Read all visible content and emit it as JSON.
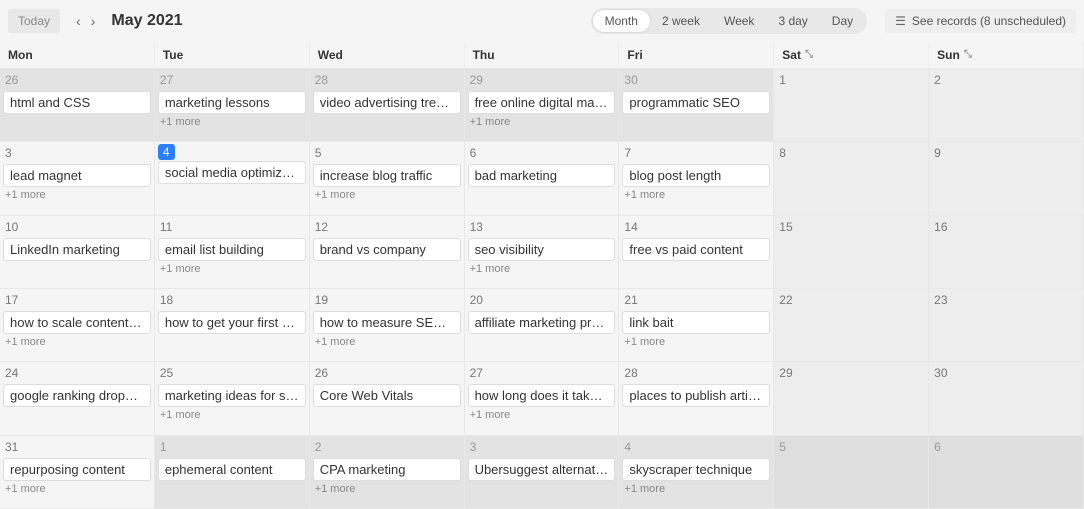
{
  "toolbar": {
    "today_label": "Today",
    "title": "May 2021",
    "views": [
      "Month",
      "2 week",
      "Week",
      "3 day",
      "Day"
    ],
    "active_view": 0,
    "records_label": "See records (8 unscheduled)"
  },
  "day_headers": [
    "Mon",
    "Tue",
    "Wed",
    "Thu",
    "Fri",
    "Sat",
    "Sun"
  ],
  "weeks": [
    [
      {
        "date": 26,
        "out": true,
        "events": [
          "html and CSS"
        ],
        "more": null
      },
      {
        "date": 27,
        "out": true,
        "events": [
          "marketing lessons"
        ],
        "more": "+1 more"
      },
      {
        "date": 28,
        "out": true,
        "events": [
          "video advertising trends"
        ],
        "more": null
      },
      {
        "date": 29,
        "out": true,
        "events": [
          "free online digital marketing"
        ],
        "more": "+1 more"
      },
      {
        "date": 30,
        "out": true,
        "events": [
          "programmatic SEO"
        ],
        "more": null
      },
      {
        "date": 1,
        "out": false,
        "weekend": true,
        "events": [],
        "more": null
      },
      {
        "date": 2,
        "out": false,
        "weekend": true,
        "events": [],
        "more": null
      }
    ],
    [
      {
        "date": 3,
        "out": false,
        "events": [
          "lead magnet"
        ],
        "more": "+1 more"
      },
      {
        "date": 4,
        "out": false,
        "today": true,
        "events": [
          "social media optimization"
        ],
        "more": null
      },
      {
        "date": 5,
        "out": false,
        "events": [
          "increase blog traffic"
        ],
        "more": "+1 more"
      },
      {
        "date": 6,
        "out": false,
        "events": [
          "bad marketing"
        ],
        "more": null
      },
      {
        "date": 7,
        "out": false,
        "events": [
          "blog post length"
        ],
        "more": "+1 more"
      },
      {
        "date": 8,
        "out": false,
        "weekend": true,
        "events": [],
        "more": null
      },
      {
        "date": 9,
        "out": false,
        "weekend": true,
        "events": [],
        "more": null
      }
    ],
    [
      {
        "date": 10,
        "out": false,
        "events": [
          "LinkedIn marketing"
        ],
        "more": null
      },
      {
        "date": 11,
        "out": false,
        "events": [
          "email list building"
        ],
        "more": "+1 more"
      },
      {
        "date": 12,
        "out": false,
        "events": [
          "brand vs company"
        ],
        "more": null
      },
      {
        "date": 13,
        "out": false,
        "events": [
          "seo visibility"
        ],
        "more": "+1 more"
      },
      {
        "date": 14,
        "out": false,
        "events": [
          "free vs paid content"
        ],
        "more": null
      },
      {
        "date": 15,
        "out": false,
        "weekend": true,
        "events": [],
        "more": null
      },
      {
        "date": 16,
        "out": false,
        "weekend": true,
        "events": [],
        "more": null
      }
    ],
    [
      {
        "date": 17,
        "out": false,
        "events": [
          "how to scale content marketing"
        ],
        "more": "+1 more"
      },
      {
        "date": 18,
        "out": false,
        "events": [
          "how to get your first customers"
        ],
        "more": null
      },
      {
        "date": 19,
        "out": false,
        "events": [
          "how to measure SEO performance"
        ],
        "more": "+1 more"
      },
      {
        "date": 20,
        "out": false,
        "events": [
          "affiliate marketing programs"
        ],
        "more": null
      },
      {
        "date": 21,
        "out": false,
        "events": [
          "link bait"
        ],
        "more": "+1 more"
      },
      {
        "date": 22,
        "out": false,
        "weekend": true,
        "events": [],
        "more": null
      },
      {
        "date": 23,
        "out": false,
        "weekend": true,
        "events": [],
        "more": null
      }
    ],
    [
      {
        "date": 24,
        "out": false,
        "events": [
          "google ranking dropped"
        ],
        "more": null
      },
      {
        "date": 25,
        "out": false,
        "events": [
          "marketing ideas for small businesses"
        ],
        "more": "+1 more"
      },
      {
        "date": 26,
        "out": false,
        "events": [
          "Core Web Vitals"
        ],
        "more": null
      },
      {
        "date": 27,
        "out": false,
        "events": [
          "how long does it take to"
        ],
        "more": "+1 more"
      },
      {
        "date": 28,
        "out": false,
        "events": [
          "places to publish articles"
        ],
        "more": null
      },
      {
        "date": 29,
        "out": false,
        "weekend": true,
        "events": [],
        "more": null
      },
      {
        "date": 30,
        "out": false,
        "weekend": true,
        "events": [],
        "more": null
      }
    ],
    [
      {
        "date": 31,
        "out": false,
        "events": [
          "repurposing content"
        ],
        "more": "+1 more"
      },
      {
        "date": 1,
        "out": true,
        "events": [
          "ephemeral content"
        ],
        "more": null
      },
      {
        "date": 2,
        "out": true,
        "events": [
          "CPA marketing"
        ],
        "more": "+1 more"
      },
      {
        "date": 3,
        "out": true,
        "events": [
          "Ubersuggest alternative"
        ],
        "more": null
      },
      {
        "date": 4,
        "out": true,
        "events": [
          "skyscraper technique"
        ],
        "more": "+1 more"
      },
      {
        "date": 5,
        "out": true,
        "weekend": true,
        "events": [],
        "more": null
      },
      {
        "date": 6,
        "out": true,
        "weekend": true,
        "events": [],
        "more": null
      }
    ]
  ]
}
